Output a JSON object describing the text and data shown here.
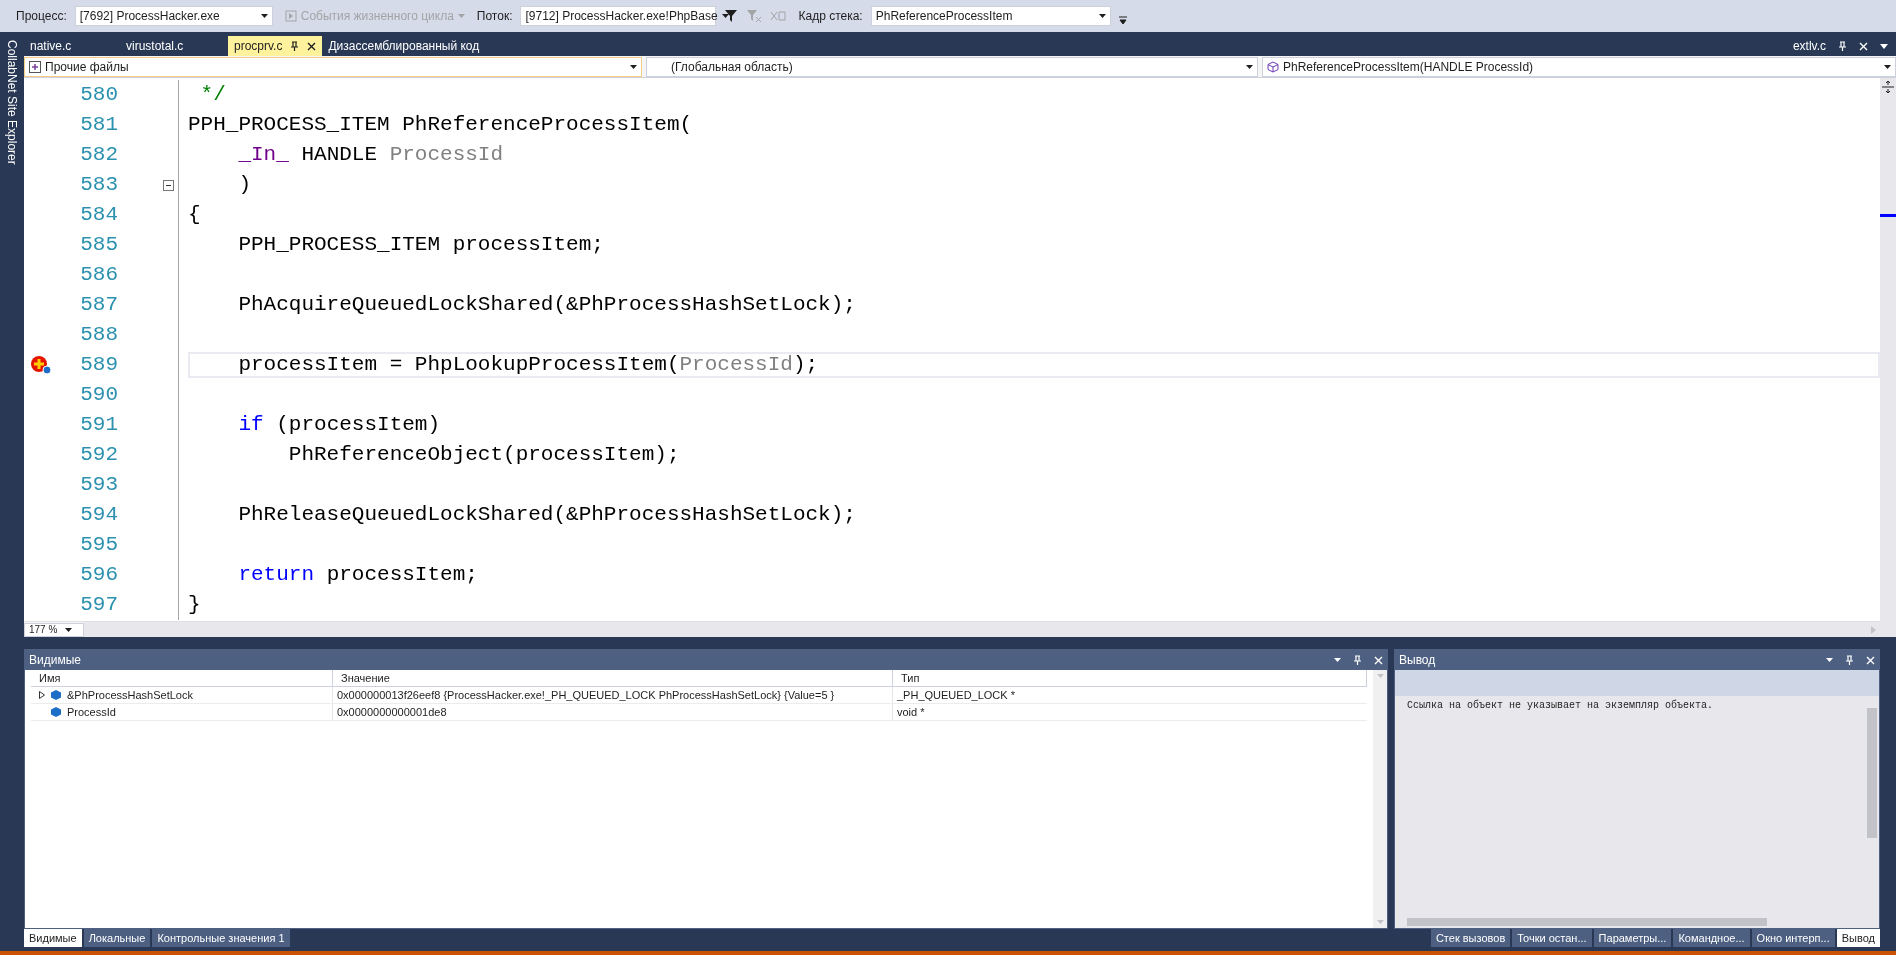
{
  "toolbar": {
    "process_label": "Процесс:",
    "process": "[7692] ProcessHacker.exe",
    "lifecycle": {
      "label": "События жизненного цикла",
      "disabled": true
    },
    "thread_label": "Поток:",
    "thread": "[9712] ProcessHacker.exe!PhpBase",
    "stack_label": "Кадр стека:",
    "stack_frame": "PhReferenceProcessItem"
  },
  "side_left": {
    "label": "CollabNet Site Explorer"
  },
  "tabs": [
    {
      "label": "native.c",
      "selected": false
    },
    {
      "label": "virustotal.c",
      "selected": false
    },
    {
      "label": "procprv.c",
      "selected": true
    },
    {
      "label": "Дизассемблированный код",
      "selected": false
    }
  ],
  "overflow_tab": "extlv.c",
  "nav": {
    "project": "Прочие файлы",
    "scope": "(Глобальная область)",
    "member": "PhReferenceProcessItem(HANDLE ProcessId)"
  },
  "editor": {
    "zoom": "177 %",
    "lines": [
      {
        "number": "580",
        "tokens": [
          {
            "kind": "comment",
            "text": " */"
          }
        ]
      },
      {
        "number": "581",
        "tokens": [
          {
            "kind": "plain",
            "text": "PPH_PROCESS_ITEM PhReferenceProcessItem("
          }
        ]
      },
      {
        "number": "582",
        "tokens": [
          {
            "kind": "macro",
            "text": "    _In_"
          },
          {
            "kind": "plain",
            "text": " HANDLE "
          },
          {
            "kind": "param",
            "text": "ProcessId"
          }
        ]
      },
      {
        "number": "583",
        "fold": true,
        "tokens": [
          {
            "kind": "plain",
            "text": "    )"
          }
        ]
      },
      {
        "number": "584",
        "tokens": [
          {
            "kind": "plain",
            "text": "{"
          }
        ]
      },
      {
        "number": "585",
        "tokens": [
          {
            "kind": "plain",
            "text": "    PPH_PROCESS_ITEM processItem;"
          }
        ]
      },
      {
        "number": "586"
      },
      {
        "number": "587",
        "tokens": [
          {
            "kind": "plain",
            "text": "    PhAcquireQueuedLockShared(&PhProcessHashSetLock);"
          }
        ]
      },
      {
        "number": "588"
      },
      {
        "number": "589",
        "breakpoint": true,
        "current": true,
        "tokens": [
          {
            "kind": "plain",
            "text": "    processItem = PhpLookupProcessItem("
          },
          {
            "kind": "param",
            "text": "ProcessId"
          },
          {
            "kind": "plain",
            "text": ");"
          }
        ]
      },
      {
        "number": "590"
      },
      {
        "number": "591",
        "tokens": [
          {
            "kind": "keyword",
            "text": "    if"
          },
          {
            "kind": "plain",
            "text": " (processItem)"
          }
        ]
      },
      {
        "number": "592",
        "tokens": [
          {
            "kind": "plain",
            "text": "        PhReferenceObject(processItem);"
          }
        ]
      },
      {
        "number": "593"
      },
      {
        "number": "594",
        "tokens": [
          {
            "kind": "plain",
            "text": "    PhReleaseQueuedLockShared(&PhProcessHashSetLock);"
          }
        ]
      },
      {
        "number": "595"
      },
      {
        "number": "596",
        "tokens": [
          {
            "kind": "keyword",
            "text": "    return"
          },
          {
            "kind": "plain",
            "text": " processItem;"
          }
        ]
      },
      {
        "number": "597",
        "tokens": [
          {
            "kind": "plain",
            "text": "}"
          }
        ]
      }
    ]
  },
  "watch": {
    "title": "Видимые",
    "columns": [
      "Имя",
      "Значение",
      "Тип"
    ],
    "rows": [
      {
        "name": "&PhProcessHashSetLock",
        "value": "0x000000013f26eef8 {ProcessHacker.exe!_PH_QUEUED_LOCK PhProcessHashSetLock} {Value=5 }",
        "type": "_PH_QUEUED_LOCK *",
        "expandable": true
      },
      {
        "name": "ProcessId",
        "value": "0x0000000000001de8",
        "type": "void *",
        "expandable": false
      }
    ]
  },
  "output": {
    "title": "Вывод",
    "text": "Ссылка на объект не указывает на экземпляр объекта."
  },
  "bottom_tabs_left": [
    {
      "label": "Видимые",
      "selected": true
    },
    {
      "label": "Локальные",
      "selected": false
    },
    {
      "label": "Контрольные значения 1",
      "selected": false
    }
  ],
  "bottom_tabs_right": [
    {
      "label": "Стек вызовов",
      "selected": false
    },
    {
      "label": "Точки остан...",
      "selected": false
    },
    {
      "label": "Параметры...",
      "selected": false
    },
    {
      "label": "Командное...",
      "selected": false
    },
    {
      "label": "Окно интерп...",
      "selected": false
    },
    {
      "label": "Вывод",
      "selected": true
    }
  ]
}
